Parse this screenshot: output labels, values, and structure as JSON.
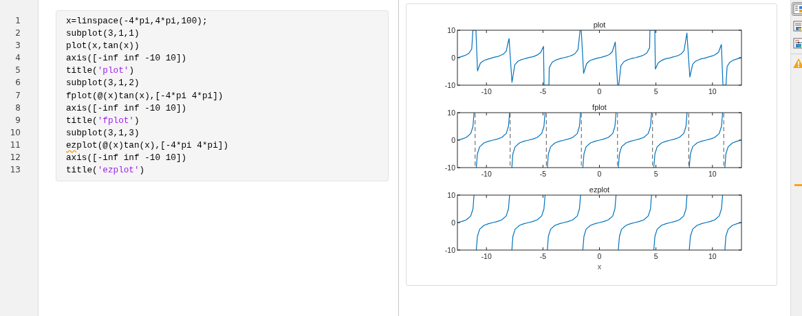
{
  "code": {
    "lines": [
      {
        "number": "1",
        "tokens": [
          {
            "kind": "code",
            "text": "x=linspace(-4*pi,4*pi,100);"
          }
        ]
      },
      {
        "number": "2",
        "tokens": [
          {
            "kind": "code",
            "text": "subplot(3,1,1)"
          }
        ]
      },
      {
        "number": "3",
        "tokens": [
          {
            "kind": "code",
            "text": "plot(x,tan(x))"
          }
        ]
      },
      {
        "number": "4",
        "tokens": [
          {
            "kind": "code",
            "text": "axis([-inf inf -10 10])"
          }
        ]
      },
      {
        "number": "5",
        "tokens": [
          {
            "kind": "code",
            "text": "title("
          },
          {
            "kind": "string",
            "text": "'plot'"
          },
          {
            "kind": "code",
            "text": ")"
          }
        ]
      },
      {
        "number": "6",
        "tokens": [
          {
            "kind": "code",
            "text": "subplot(3,1,2)"
          }
        ]
      },
      {
        "number": "7",
        "tokens": [
          {
            "kind": "code",
            "text": "fplot(@(x)tan(x),[-4*pi 4*pi])"
          }
        ]
      },
      {
        "number": "8",
        "tokens": [
          {
            "kind": "code",
            "text": "axis([-inf inf -10 10])"
          }
        ]
      },
      {
        "number": "9",
        "tokens": [
          {
            "kind": "code",
            "text": "title("
          },
          {
            "kind": "string",
            "text": "'fplot'"
          },
          {
            "kind": "code",
            "text": ")"
          }
        ]
      },
      {
        "number": "10",
        "tokens": [
          {
            "kind": "code",
            "text": "subplot(3,1,3)"
          }
        ]
      },
      {
        "number": "11",
        "tokens": [
          {
            "kind": "warning",
            "text": "ez"
          },
          {
            "kind": "code",
            "text": "plot(@(x)tan(x),[-4*pi 4*pi])"
          }
        ]
      },
      {
        "number": "12",
        "tokens": [
          {
            "kind": "code",
            "text": "axis([-inf inf -10 10])"
          }
        ]
      },
      {
        "number": "13",
        "tokens": [
          {
            "kind": "code",
            "text": "title("
          },
          {
            "kind": "string",
            "text": "'ezplot'"
          },
          {
            "kind": "code",
            "text": ")"
          }
        ]
      }
    ]
  },
  "output": {
    "figures": [
      {
        "chart_data": {
          "type": "line",
          "title": "plot",
          "xlim": [
            -12.57,
            12.57
          ],
          "ylim": [
            -10,
            10
          ],
          "xticks": [
            -10,
            -5,
            0,
            5,
            10
          ],
          "yticks": [
            -10,
            0,
            10
          ],
          "x": [
            -12.57,
            -12.31,
            -12.06,
            -11.8,
            -11.55,
            -11.3,
            -11.2,
            -10.93,
            -10.79,
            -10.54,
            -10.28,
            -10.03,
            -9.77,
            -9.52,
            -9.27,
            -9.01,
            -8.76,
            -8.5,
            -8.25,
            -8.0,
            -7.74,
            -7.49,
            -7.24,
            -6.98,
            -6.73,
            -6.47,
            -6.22,
            -5.97,
            -5.71,
            -5.46,
            -5.2,
            -4.95,
            -4.9,
            -4.47,
            -4.44,
            -4.19,
            -3.93,
            -3.68,
            -3.43,
            -3.17,
            -2.92,
            -2.67,
            -2.41,
            -2.16,
            -1.9,
            -1.71,
            -1.61,
            -1.4,
            -1.14,
            -0.89,
            -0.63,
            -0.38,
            -0.13,
            0.13,
            0.38,
            0.63,
            0.89,
            1.14,
            1.4,
            1.61,
            1.71,
            1.9,
            2.16,
            2.41,
            2.67,
            2.92,
            3.17,
            3.43,
            3.68,
            3.93,
            4.19,
            4.44,
            4.47,
            4.9,
            4.95,
            5.2,
            5.46,
            5.71,
            5.97,
            6.22,
            6.47,
            6.73,
            6.98,
            7.24,
            7.49,
            7.74,
            8.0,
            8.25,
            8.5,
            8.76,
            9.01,
            9.27,
            9.52,
            9.77,
            10.03,
            10.28,
            10.54,
            10.79,
            10.93,
            11.2,
            11.3,
            11.55,
            11.8,
            12.06,
            12.31,
            12.57
          ],
          "series": [
            {
              "color": "#0072bd",
              "values": [
                0,
                0.3,
                0.6,
                1,
                1.6,
                3.2,
                10,
                10,
                -4.8,
                -2,
                -1.2,
                -0.7,
                -0.4,
                -0.1,
                0.2,
                0.4,
                0.8,
                1.3,
                2.4,
                7,
                -9,
                -2.6,
                -1.4,
                -0.8,
                -0.5,
                -0.2,
                0.1,
                0.3,
                0.6,
                1.1,
                1.9,
                4.1,
                -10,
                -10,
                -3.6,
                -1.7,
                -1,
                -0.6,
                -0.3,
                0,
                0.2,
                0.5,
                0.9,
                1.5,
                2.9,
                10,
                10,
                -5.7,
                -2.2,
                -1.2,
                -0.7,
                -0.4,
                -0.1,
                0.1,
                0.4,
                0.7,
                1.2,
                2.2,
                5.7,
                -10,
                -10,
                -2.9,
                -1.5,
                -0.9,
                -0.5,
                -0.2,
                0,
                0.3,
                0.6,
                1,
                1.7,
                3.6,
                10,
                10,
                -4.1,
                -1.9,
                -1.1,
                -0.6,
                -0.3,
                -0.1,
                0.2,
                0.5,
                0.8,
                1.4,
                2.6,
                9,
                -7,
                -2.4,
                -1.3,
                -0.8,
                -0.4,
                -0.2,
                0.1,
                0.4,
                0.7,
                1.2,
                2,
                4.8,
                -10,
                -10,
                -3.2,
                -1.6,
                -1,
                -0.6,
                -0.3,
                0
              ]
            }
          ]
        }
      },
      {
        "chart_data": {
          "type": "line",
          "title": "fplot",
          "xlim": [
            -12.57,
            12.57
          ],
          "ylim": [
            -10,
            10
          ],
          "xticks": [
            -10,
            -5,
            0,
            5,
            10
          ],
          "yticks": [
            -10,
            0,
            10
          ],
          "x": [
            -12.57,
            -12.17,
            -11.78,
            -11.39,
            -11.19,
            -11.1,
            null,
            -10.9,
            -10.8,
            -10.6,
            -10.21,
            -9.82,
            -9.42,
            -9.03,
            -8.64,
            -8.25,
            -8.05,
            -7.95,
            null,
            -7.75,
            -7.66,
            -7.46,
            -7.07,
            -6.68,
            -6.28,
            -5.89,
            -5.5,
            -5.11,
            -4.91,
            -4.81,
            null,
            -4.61,
            -4.52,
            -4.32,
            -3.93,
            -3.53,
            -3.14,
            -2.75,
            -2.36,
            -1.96,
            -1.77,
            -1.67,
            null,
            -1.47,
            -1.37,
            -1.18,
            -0.79,
            -0.39,
            0,
            0.39,
            0.79,
            1.18,
            1.37,
            1.47,
            null,
            1.67,
            1.77,
            1.96,
            2.36,
            2.75,
            3.14,
            3.53,
            3.93,
            4.32,
            4.52,
            4.61,
            null,
            4.81,
            4.91,
            5.11,
            5.5,
            5.89,
            6.28,
            6.68,
            7.07,
            7.46,
            7.66,
            7.75,
            null,
            7.95,
            8.05,
            8.25,
            8.64,
            9.03,
            9.42,
            9.82,
            10.21,
            10.6,
            10.8,
            10.9,
            null,
            11.1,
            11.19,
            11.39,
            11.78,
            12.17,
            12.57
          ],
          "series": [
            {
              "color": "#0072bd",
              "values": [
                0,
                0.4,
                1,
                2.4,
                5,
                10,
                null,
                -10,
                -5,
                -2.4,
                -1,
                -0.4,
                0,
                0.4,
                1,
                2.4,
                5,
                10,
                null,
                -10,
                -5,
                -2.4,
                -1,
                -0.4,
                0,
                0.4,
                1,
                2.4,
                5,
                10,
                null,
                -10,
                -5,
                -2.4,
                -1,
                -0.4,
                0,
                0.4,
                1,
                2.4,
                5,
                10,
                null,
                -10,
                -5,
                -2.4,
                -1,
                -0.4,
                0,
                0.4,
                1,
                2.4,
                5,
                10,
                null,
                -10,
                -5,
                -2.4,
                -1,
                -0.4,
                0,
                0.4,
                1,
                2.4,
                5,
                10,
                null,
                -10,
                -5,
                -2.4,
                -1,
                -0.4,
                0,
                0.4,
                1,
                2.4,
                5,
                10,
                null,
                -10,
                -5,
                -2.4,
                -1,
                -0.4,
                0,
                0.4,
                1,
                2.4,
                5,
                10,
                null,
                -10,
                -5,
                -2.4,
                -1,
                -0.4,
                0
              ]
            }
          ],
          "ref_lines": [
            {
              "axis": "x",
              "value": -11.0
            },
            {
              "axis": "x",
              "value": -7.9
            },
            {
              "axis": "x",
              "value": -4.7
            },
            {
              "axis": "x",
              "value": -1.6
            },
            {
              "axis": "x",
              "value": 1.6
            },
            {
              "axis": "x",
              "value": 4.7
            },
            {
              "axis": "x",
              "value": 7.9
            },
            {
              "axis": "x",
              "value": 11.0
            }
          ]
        }
      },
      {
        "chart_data": {
          "type": "line",
          "title": "ezplot",
          "xlabel": "x",
          "xlim": [
            -12.57,
            12.57
          ],
          "ylim": [
            -10,
            10
          ],
          "xticks": [
            -10,
            -5,
            0,
            5,
            10
          ],
          "yticks": [
            -10,
            0,
            10
          ],
          "x": [
            -12.57,
            -12.17,
            -11.78,
            -11.39,
            -11.19,
            -11.1,
            null,
            -10.9,
            -10.8,
            -10.6,
            -10.21,
            -9.82,
            -9.42,
            -9.03,
            -8.64,
            -8.25,
            -8.05,
            -7.95,
            null,
            -7.75,
            -7.66,
            -7.46,
            -7.07,
            -6.68,
            -6.28,
            -5.89,
            -5.5,
            -5.11,
            -4.91,
            -4.81,
            null,
            -4.61,
            -4.52,
            -4.32,
            -3.93,
            -3.53,
            -3.14,
            -2.75,
            -2.36,
            -1.96,
            -1.77,
            -1.67,
            null,
            -1.47,
            -1.37,
            -1.18,
            -0.79,
            -0.39,
            0,
            0.39,
            0.79,
            1.18,
            1.37,
            1.47,
            null,
            1.67,
            1.77,
            1.96,
            2.36,
            2.75,
            3.14,
            3.53,
            3.93,
            4.32,
            4.52,
            4.61,
            null,
            4.81,
            4.91,
            5.11,
            5.5,
            5.89,
            6.28,
            6.68,
            7.07,
            7.46,
            7.66,
            7.75,
            null,
            7.95,
            8.05,
            8.25,
            8.64,
            9.03,
            9.42,
            9.82,
            10.21,
            10.6,
            10.8,
            10.9,
            null,
            11.1,
            11.19,
            11.39,
            11.78,
            12.17,
            12.57
          ],
          "series": [
            {
              "color": "#0072bd",
              "values": [
                0,
                0.4,
                1,
                2.4,
                5,
                10,
                null,
                -10,
                -5,
                -2.4,
                -1,
                -0.4,
                0,
                0.4,
                1,
                2.4,
                5,
                10,
                null,
                -10,
                -5,
                -2.4,
                -1,
                -0.4,
                0,
                0.4,
                1,
                2.4,
                5,
                10,
                null,
                -10,
                -5,
                -2.4,
                -1,
                -0.4,
                0,
                0.4,
                1,
                2.4,
                5,
                10,
                null,
                -10,
                -5,
                -2.4,
                -1,
                -0.4,
                0,
                0.4,
                1,
                2.4,
                5,
                10,
                null,
                -10,
                -5,
                -2.4,
                -1,
                -0.4,
                0,
                0.4,
                1,
                2.4,
                5,
                10,
                null,
                -10,
                -5,
                -2.4,
                -1,
                -0.4,
                0,
                0.4,
                1,
                2.4,
                5,
                10,
                null,
                -10,
                -5,
                -2.4,
                -1,
                -0.4,
                0,
                0.4,
                1,
                2.4,
                5,
                10,
                null,
                -10,
                -5,
                -2.4,
                -1,
                -0.4,
                0
              ]
            }
          ]
        }
      }
    ]
  },
  "side_toolbar": [
    {
      "kind": "output-right",
      "selected": true
    },
    {
      "kind": "output-inline",
      "selected": false
    },
    {
      "kind": "hide-code",
      "selected": false
    }
  ]
}
